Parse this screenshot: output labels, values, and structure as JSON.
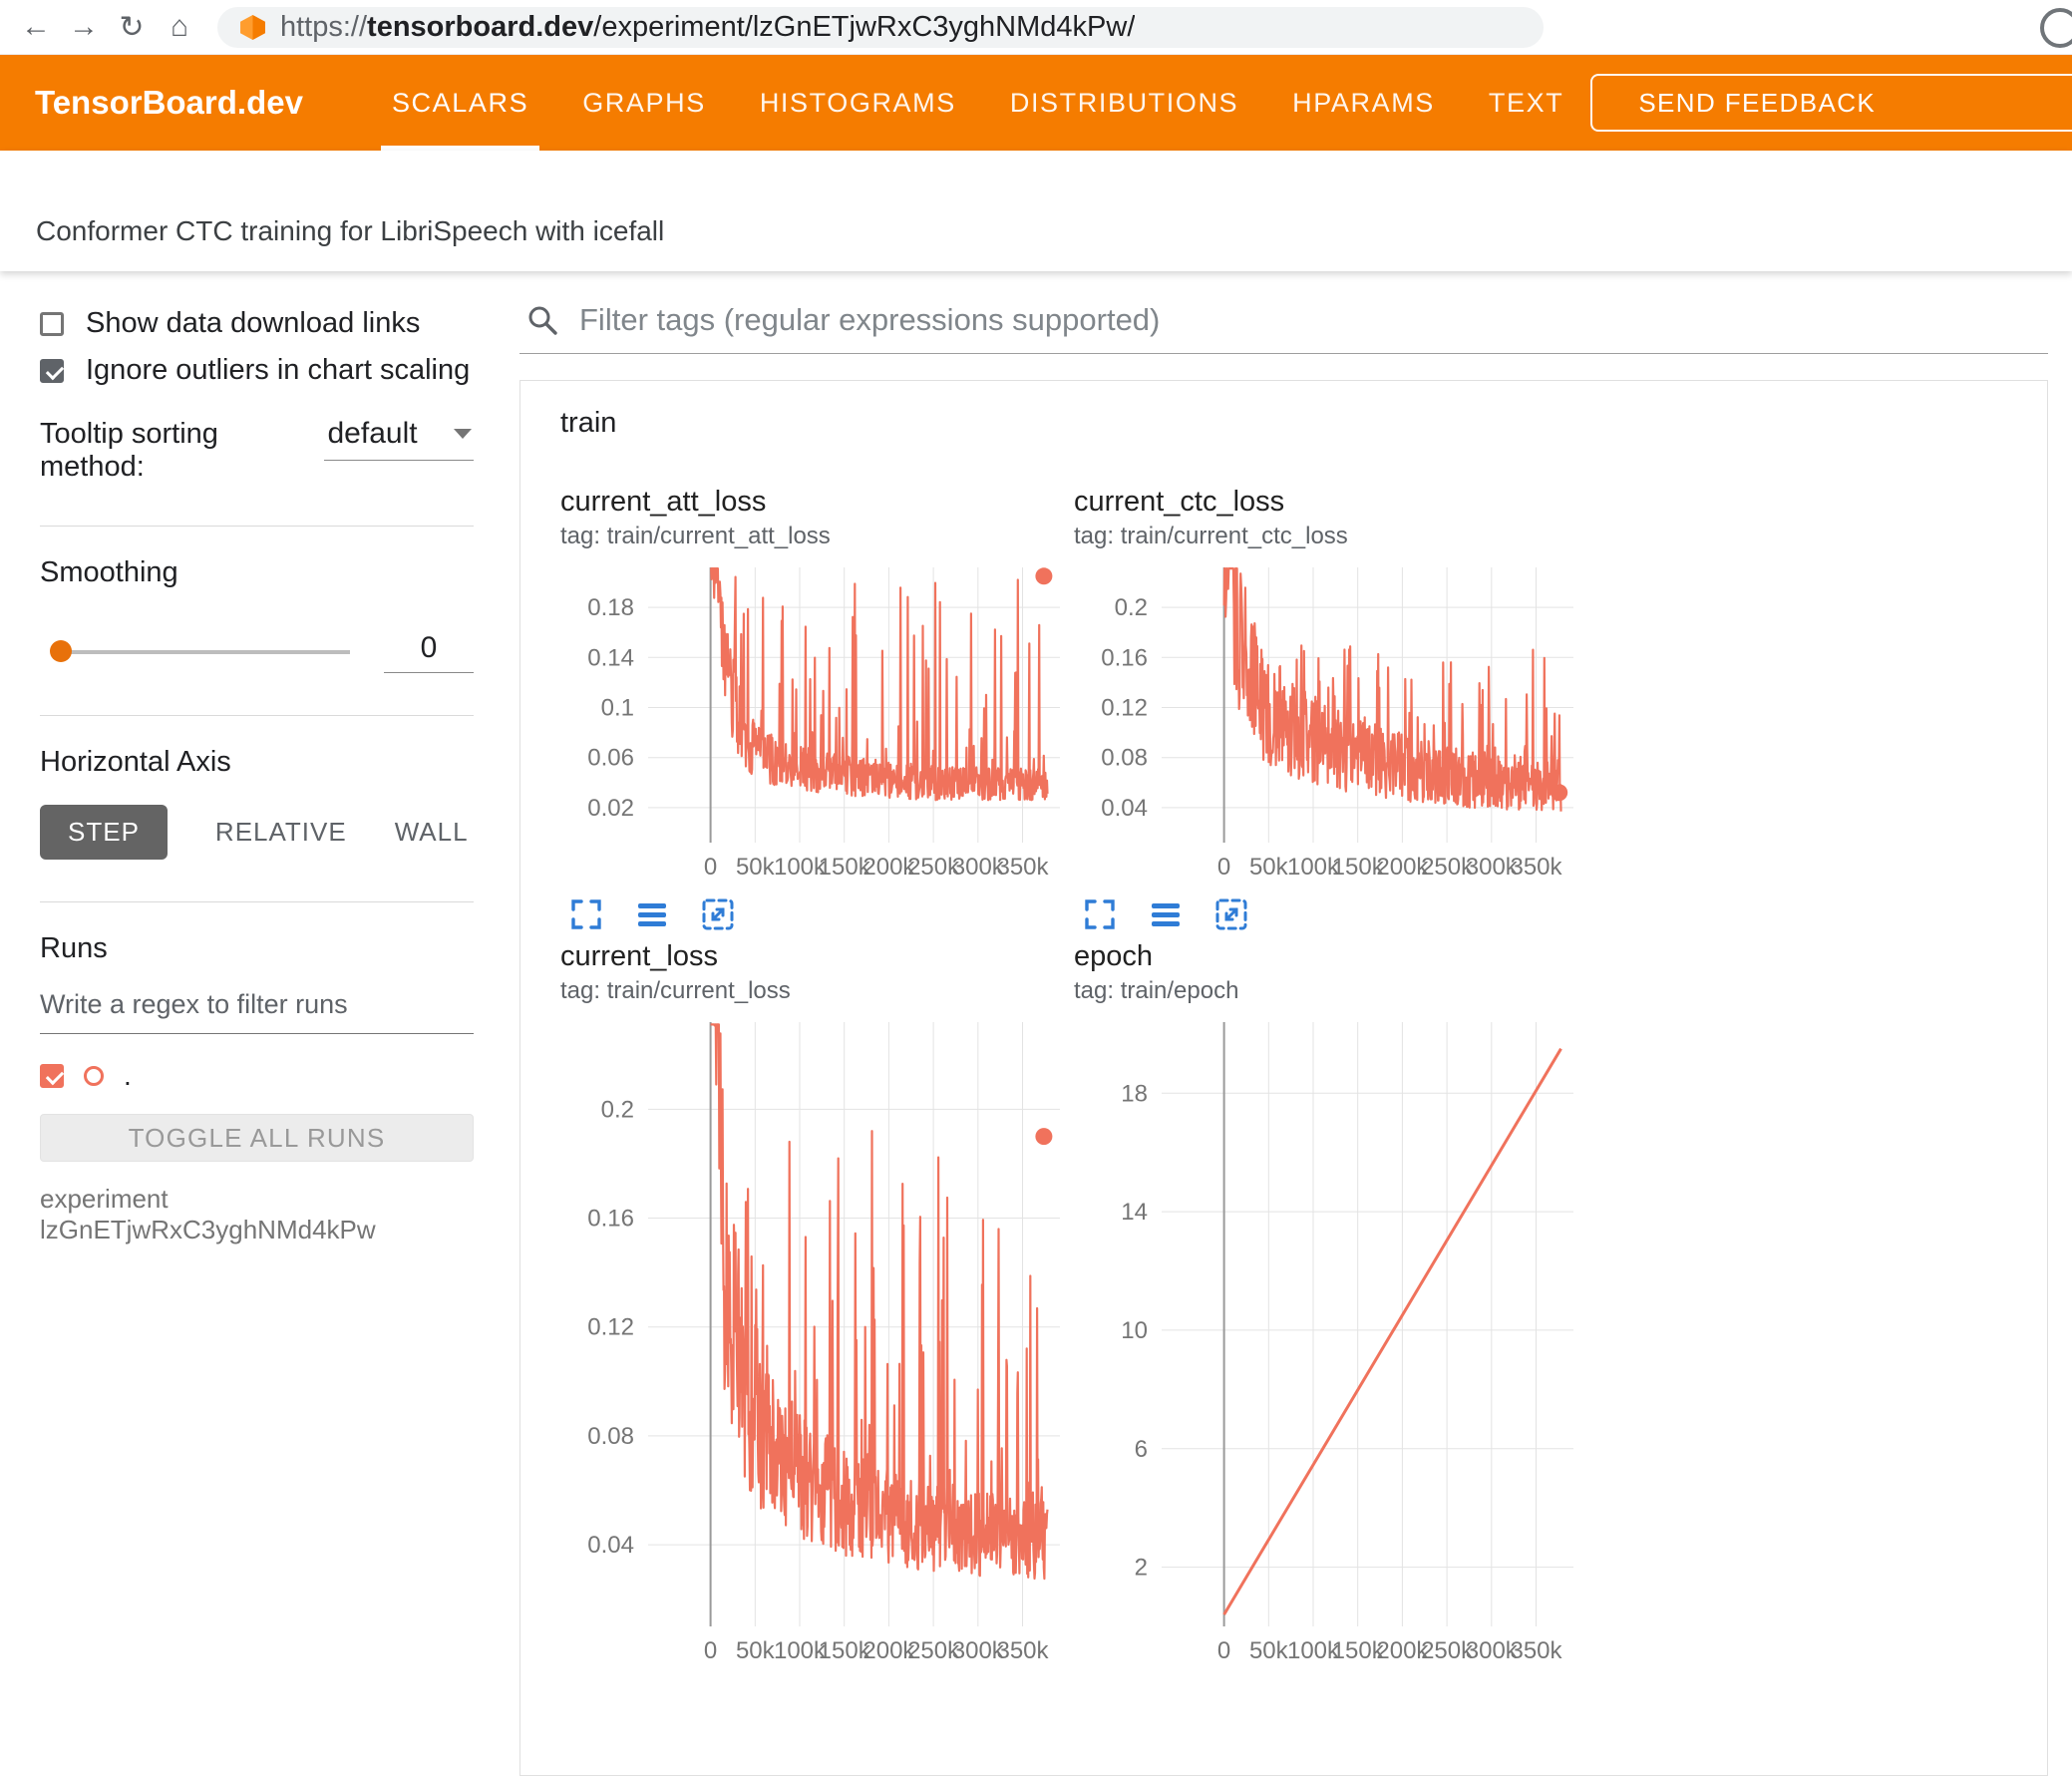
{
  "browser": {
    "url_scheme": "https://",
    "url_domain": "tensorboard.dev",
    "url_path": "/experiment/lzGnETjwRxC3yghNMd4kPw/"
  },
  "header": {
    "logo": "TensorBoard.dev",
    "tabs": [
      {
        "label": "SCALARS",
        "active": true
      },
      {
        "label": "GRAPHS",
        "active": false
      },
      {
        "label": "HISTOGRAMS",
        "active": false
      },
      {
        "label": "DISTRIBUTIONS",
        "active": false
      },
      {
        "label": "HPARAMS",
        "active": false
      },
      {
        "label": "TEXT",
        "active": false
      }
    ],
    "feedback_button": "SEND FEEDBACK"
  },
  "experiment": {
    "title": "Conformer CTC training for LibriSpeech with icefall"
  },
  "sidebar": {
    "show_download": {
      "label": "Show data download links",
      "checked": false
    },
    "ignore_outliers": {
      "label": "Ignore outliers in chart scaling",
      "checked": true
    },
    "tooltip_sorting": {
      "label": "Tooltip sorting method:",
      "value": "default"
    },
    "smoothing": {
      "label": "Smoothing",
      "value": "0"
    },
    "horizontal_axis": {
      "label": "Horizontal Axis",
      "options": [
        "STEP",
        "RELATIVE",
        "WALL"
      ],
      "selected": "STEP"
    },
    "runs": {
      "label": "Runs",
      "filter_placeholder": "Write a regex to filter runs",
      "run_item_label": ".",
      "run_checked": true,
      "toggle_button": "TOGGLE ALL RUNS",
      "experiment_label": "experiment lzGnETjwRxC3yghNMd4kPw"
    }
  },
  "main": {
    "filter_placeholder": "Filter tags (regular expressions supported)",
    "card_title": "train"
  },
  "colors": {
    "header_orange": "#f57c00",
    "run_line": "#f0725c",
    "icon_blue": "#2f7cd6",
    "axis_text": "#757575",
    "grid_line": "#e3e3e3",
    "origin_line": "#9a9a9a"
  },
  "chart_data": [
    {
      "id": "current_att_loss",
      "type": "noisy-line",
      "title": "current_att_loss",
      "tag": "tag: train/current_att_loss",
      "x_tick_values": [
        0,
        50000,
        100000,
        150000,
        200000,
        250000,
        300000,
        350000
      ],
      "x_tick_labels": [
        "0",
        "50k",
        "100k",
        "150k",
        "200k",
        "250k",
        "300k",
        "350k"
      ],
      "y_ticks": [
        0.02,
        0.06,
        0.1,
        0.14,
        0.18
      ],
      "y_tick_labels": [
        "0.02",
        "0.06",
        "0.1",
        "0.14",
        "0.18"
      ],
      "x_range": [
        -70000,
        392000
      ],
      "y_range": [
        -0.008,
        0.212
      ],
      "x_data": [
        0,
        378000
      ],
      "trend": [
        [
          0,
          0.3
        ],
        [
          15000,
          0.13
        ],
        [
          40000,
          0.07
        ],
        [
          80000,
          0.055
        ],
        [
          150000,
          0.045
        ],
        [
          250000,
          0.04
        ],
        [
          378000,
          0.038
        ]
      ],
      "jitter": 0.7,
      "spike_prob": 0.17,
      "spike_max": 0.205,
      "seed": 11,
      "n_points": 650,
      "end_dot": [
        374000,
        0.205
      ]
    },
    {
      "id": "current_ctc_loss",
      "type": "noisy-line",
      "title": "current_ctc_loss",
      "tag": "tag: train/current_ctc_loss",
      "x_tick_values": [
        0,
        50000,
        100000,
        150000,
        200000,
        250000,
        300000,
        350000
      ],
      "x_tick_labels": [
        "0",
        "50k",
        "100k",
        "150k",
        "200k",
        "250k",
        "300k",
        "350k"
      ],
      "y_ticks": [
        0.04,
        0.08,
        0.12,
        0.16,
        0.2
      ],
      "y_tick_labels": [
        "0.04",
        "0.08",
        "0.12",
        "0.16",
        "0.2"
      ],
      "x_range": [
        -70000,
        392000
      ],
      "y_range": [
        0.012,
        0.232
      ],
      "x_data": [
        0,
        378000
      ],
      "trend": [
        [
          0,
          0.32
        ],
        [
          15000,
          0.19
        ],
        [
          40000,
          0.125
        ],
        [
          80000,
          0.1
        ],
        [
          150000,
          0.08
        ],
        [
          250000,
          0.065
        ],
        [
          378000,
          0.058
        ]
      ],
      "jitter": 0.75,
      "spike_prob": 0.15,
      "spike_max": 0.17,
      "seed": 23,
      "n_points": 650,
      "end_dot": [
        376000,
        0.052
      ]
    },
    {
      "id": "current_loss",
      "type": "noisy-line",
      "title": "current_loss",
      "tag": "tag: train/current_loss",
      "x_tick_values": [
        0,
        50000,
        100000,
        150000,
        200000,
        250000,
        300000,
        350000
      ],
      "x_tick_labels": [
        "0",
        "50k",
        "100k",
        "150k",
        "200k",
        "250k",
        "300k",
        "350k"
      ],
      "y_ticks": [
        0.04,
        0.08,
        0.12,
        0.16,
        0.2
      ],
      "y_tick_labels": [
        "0.04",
        "0.08",
        "0.12",
        "0.16",
        "0.2"
      ],
      "x_range": [
        -70000,
        392000
      ],
      "y_range": [
        0.01,
        0.232
      ],
      "x_data": [
        0,
        378000
      ],
      "trend": [
        [
          0,
          0.32
        ],
        [
          15000,
          0.15
        ],
        [
          40000,
          0.09
        ],
        [
          80000,
          0.07
        ],
        [
          150000,
          0.055
        ],
        [
          250000,
          0.045
        ],
        [
          378000,
          0.042
        ]
      ],
      "jitter": 0.7,
      "spike_prob": 0.17,
      "spike_max": 0.2,
      "seed": 37,
      "n_points": 650,
      "end_dot": [
        374000,
        0.19
      ]
    },
    {
      "id": "epoch",
      "type": "line",
      "title": "epoch",
      "tag": "tag: train/epoch",
      "x_tick_values": [
        0,
        50000,
        100000,
        150000,
        200000,
        250000,
        300000,
        350000
      ],
      "x_tick_labels": [
        "0",
        "50k",
        "100k",
        "150k",
        "200k",
        "250k",
        "300k",
        "350k"
      ],
      "y_ticks": [
        2,
        6,
        10,
        14,
        18
      ],
      "y_tick_labels": [
        "2",
        "6",
        "10",
        "14",
        "18"
      ],
      "x_range": [
        -70000,
        392000
      ],
      "y_range": [
        0,
        20.4
      ],
      "points": [
        [
          0,
          0.4
        ],
        [
          378000,
          19.5
        ]
      ]
    }
  ]
}
